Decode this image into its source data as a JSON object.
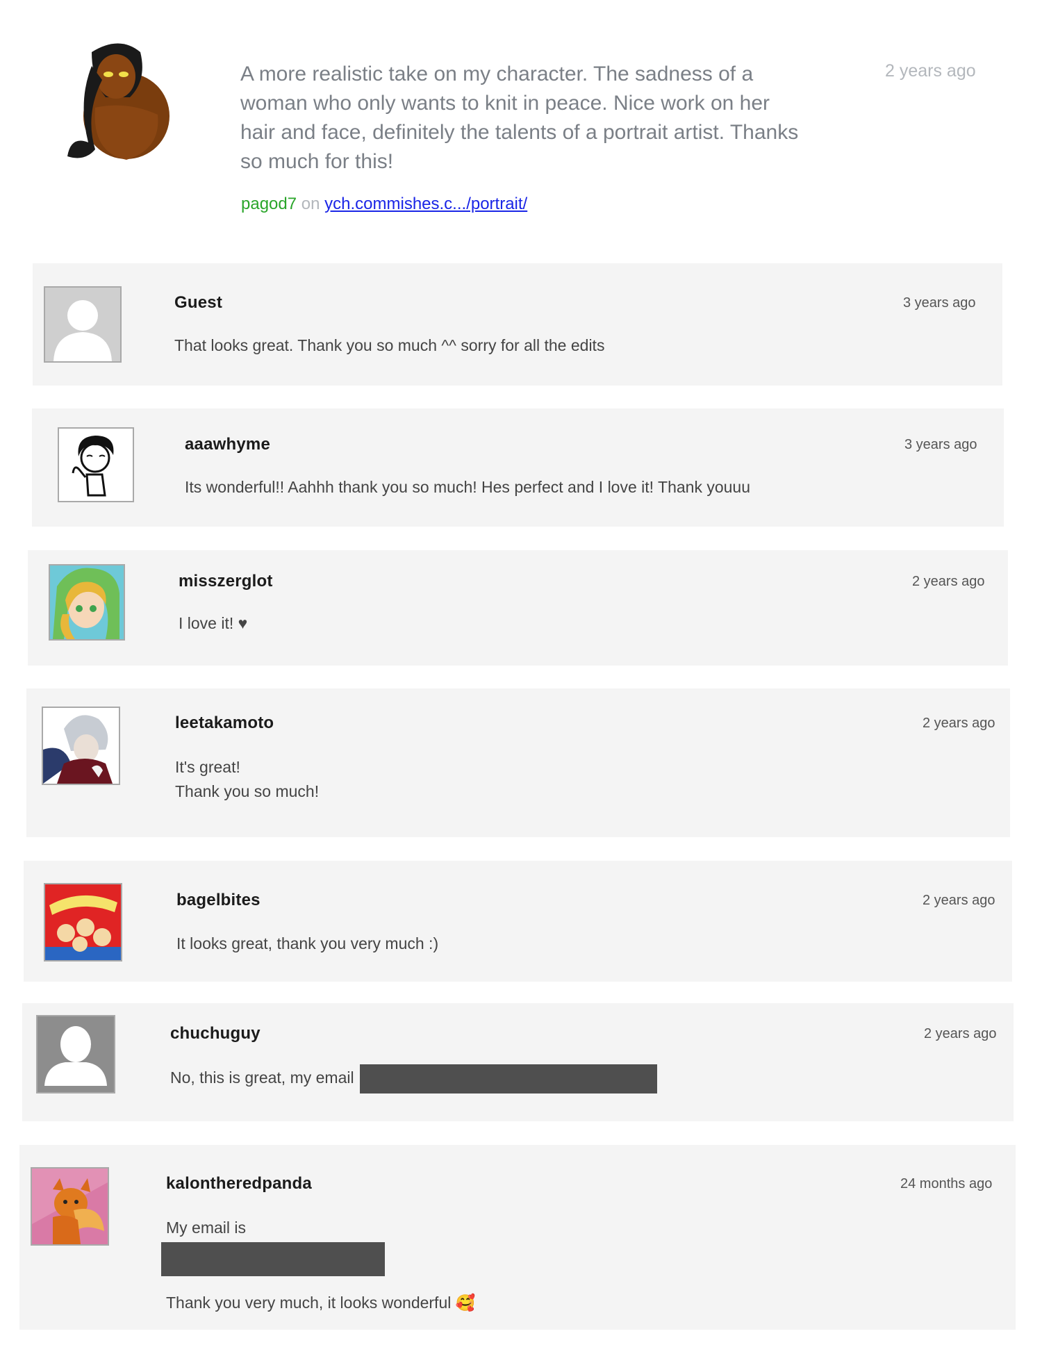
{
  "featured": {
    "avatar_icon": "character-portrait-icon",
    "text": "A more realistic take on my character. The sadness of a woman who only wants to knit in peace. Nice work on her hair and face, definitely the talents of a portrait artist. Thanks so much for this!",
    "time": "2 years ago",
    "author": "pagod7",
    "on_label": "on",
    "link_text": "ych.commishes.c.../portrait/"
  },
  "comments": [
    {
      "name": "Guest",
      "time": "3 years ago",
      "avatar_icon": "default-user-icon",
      "lines": [
        "That looks great. Thank you so much ^^ sorry for all the edits"
      ]
    },
    {
      "name": "aaawhyme",
      "time": "3 years ago",
      "avatar_icon": "sketch-avatar-icon",
      "lines": [
        "Its wonderful!! Aahhh thank you so much! Hes perfect and I love it! Thank youuu"
      ]
    },
    {
      "name": "misszerglot",
      "time": "2 years ago",
      "avatar_icon": "anime-girl-avatar-icon",
      "lines": [
        "I love it! ♥"
      ]
    },
    {
      "name": "leetakamoto",
      "time": "2 years ago",
      "avatar_icon": "anime-boy-avatar-icon",
      "lines": [
        "It's great!",
        "Thank you so much!"
      ]
    },
    {
      "name": "bagelbites",
      "time": "2 years ago",
      "avatar_icon": "bagel-bites-box-icon",
      "lines": [
        "It looks great, thank you very much :)"
      ]
    },
    {
      "name": "chuchuguy",
      "time": "2 years ago",
      "avatar_icon": "default-user-icon",
      "lines": [
        "No, this is great, my email"
      ]
    },
    {
      "name": "kalontheredpanda",
      "time": "24 months ago",
      "avatar_icon": "red-panda-avatar-icon",
      "lines": [
        "My email is",
        "Thank you very much, it looks wonderful 🥰"
      ]
    }
  ]
}
